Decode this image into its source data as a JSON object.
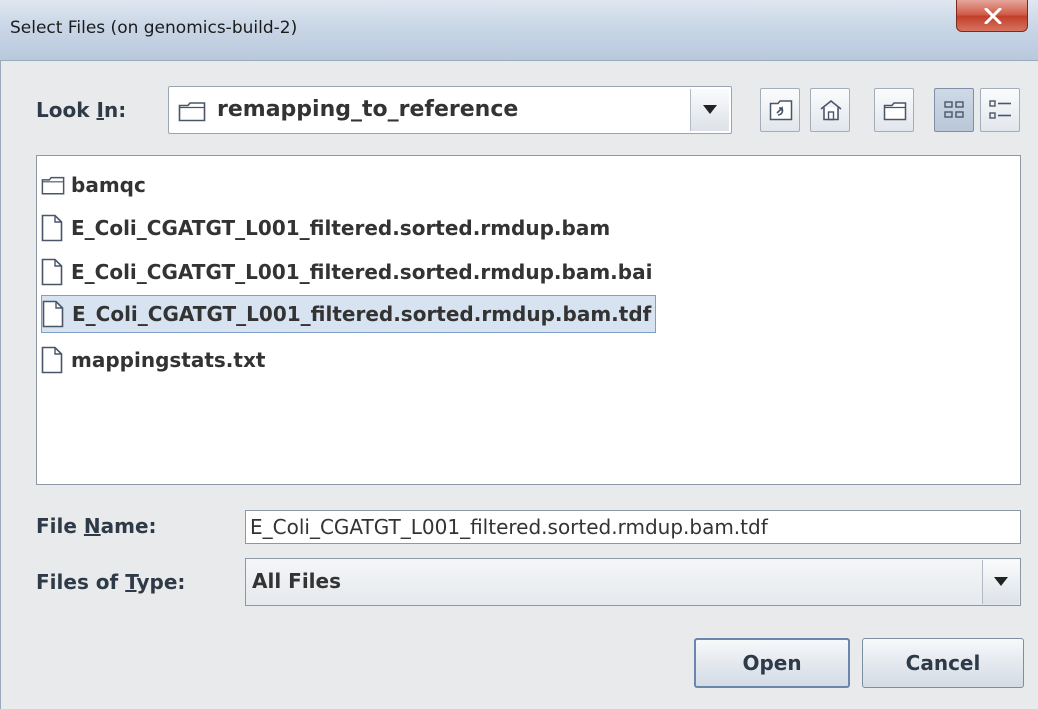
{
  "window": {
    "title": "Select Files (on genomics-build-2)",
    "close_glyph": "X"
  },
  "look_in": {
    "label_before": "Look ",
    "label_mnemonic": "I",
    "label_after": "n:",
    "current_folder": "remapping_to_reference"
  },
  "toolbar": {
    "buttons": [
      {
        "name": "up-one-level-icon"
      },
      {
        "name": "home-icon"
      },
      {
        "name": "new-folder-icon"
      },
      {
        "name": "list-view-icon",
        "pressed": true
      },
      {
        "name": "details-view-icon"
      }
    ]
  },
  "files": [
    {
      "name": "bamqc",
      "type": "folder",
      "selected": false
    },
    {
      "name": "E_Coli_CGATGT_L001_filtered.sorted.rmdup.bam",
      "type": "file",
      "selected": false
    },
    {
      "name": "E_Coli_CGATGT_L001_filtered.sorted.rmdup.bam.bai",
      "type": "file",
      "selected": false
    },
    {
      "name": "E_Coli_CGATGT_L001_filtered.sorted.rmdup.bam.tdf",
      "type": "file",
      "selected": true
    },
    {
      "name": "mappingstats.txt",
      "type": "file",
      "selected": false
    }
  ],
  "file_name": {
    "label_before": "File ",
    "label_mnemonic": "N",
    "label_after": "ame:",
    "value": "E_Coli_CGATGT_L001_filtered.sorted.rmdup.bam.tdf"
  },
  "file_type": {
    "label_before": "Files of ",
    "label_mnemonic": "T",
    "label_after": "ype:",
    "selected": "All Files"
  },
  "buttons": {
    "open": "Open",
    "cancel": "Cancel"
  },
  "colors": {
    "selection_bg": "#d7e3f1",
    "selection_border": "#7ea0c7",
    "close_red": "#c13f2a"
  }
}
